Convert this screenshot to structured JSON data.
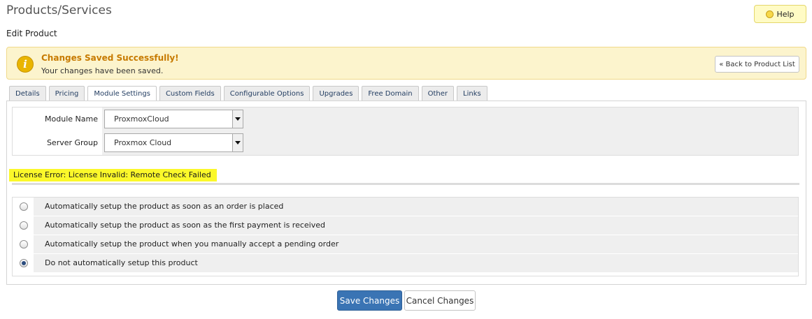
{
  "header": {
    "title": "Products/Services",
    "subtitle": "Edit Product",
    "help_label": "Help"
  },
  "alert": {
    "title": "Changes Saved Successfully!",
    "message": "Your changes have been saved.",
    "back_label": "« Back to Product List"
  },
  "tabs": [
    {
      "label": "Details",
      "active": false
    },
    {
      "label": "Pricing",
      "active": false
    },
    {
      "label": "Module Settings",
      "active": true
    },
    {
      "label": "Custom Fields",
      "active": false
    },
    {
      "label": "Configurable Options",
      "active": false
    },
    {
      "label": "Upgrades",
      "active": false
    },
    {
      "label": "Free Domain",
      "active": false
    },
    {
      "label": "Other",
      "active": false
    },
    {
      "label": "Links",
      "active": false
    }
  ],
  "module": {
    "module_name_label": "Module Name",
    "module_name_value": "ProxmoxCloud",
    "server_group_label": "Server Group",
    "server_group_value": "Proxmox Cloud",
    "license_error": "License Error: License Invalid: Remote Check Failed"
  },
  "setup_options": [
    {
      "label": "Automatically setup the product as soon as an order is placed",
      "checked": false
    },
    {
      "label": "Automatically setup the product as soon as the first payment is received",
      "checked": false
    },
    {
      "label": "Automatically setup the product when you manually accept a pending order",
      "checked": false
    },
    {
      "label": "Do not automatically setup this product",
      "checked": true
    }
  ],
  "actions": {
    "save_label": "Save Changes",
    "cancel_label": "Cancel Changes"
  },
  "colors": {
    "alert_bg": "#fcf4cd",
    "alert_title": "#c77a00",
    "highlight": "#fbf82a",
    "primary_button": "#3a74b4"
  }
}
